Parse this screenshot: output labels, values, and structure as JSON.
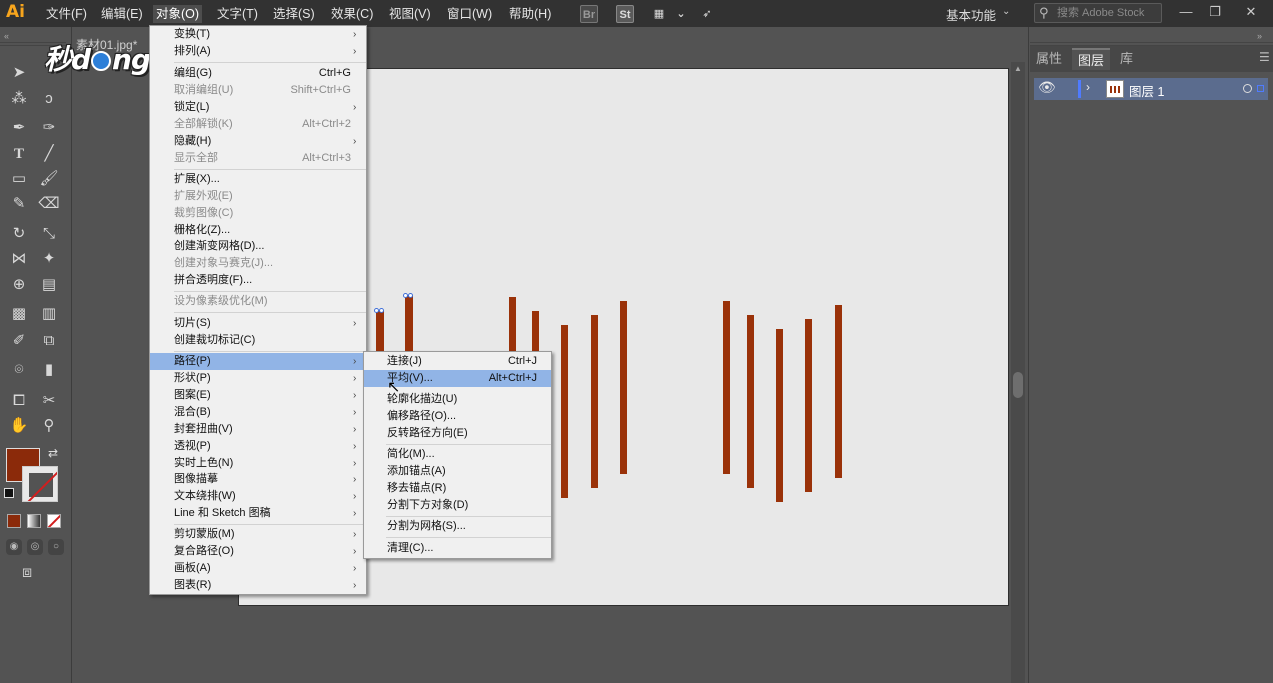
{
  "app": {
    "logo": "Ai",
    "menus": [
      "文件(F)",
      "编辑(E)",
      "对象(O)",
      "文字(T)",
      "选择(S)",
      "效果(C)",
      "视图(V)",
      "窗口(W)",
      "帮助(H)"
    ],
    "bridge_label": "Br",
    "stock_label": "St",
    "workspace": "基本功能",
    "stock_search_placeholder": "搜索 Adobe Stock"
  },
  "document": {
    "tab_title": "素材01.jpg*",
    "watermark": {
      "part1": "秒d",
      "part2": "ng视频"
    }
  },
  "colors": {
    "fill": "#8b2a0a",
    "bars": "#9a3209",
    "layer_color": "#4f7bff",
    "menu_highlight": "#91b4e6"
  },
  "object_menu": {
    "items": [
      {
        "label": "变换(T)",
        "shortcut": "",
        "submenu": true,
        "disabled": false
      },
      {
        "label": "排列(A)",
        "shortcut": "",
        "submenu": true,
        "disabled": false
      },
      {
        "label": "编组(G)",
        "shortcut": "Ctrl+G",
        "submenu": false,
        "disabled": false
      },
      {
        "label": "取消编组(U)",
        "shortcut": "Shift+Ctrl+G",
        "submenu": false,
        "disabled": true
      },
      {
        "label": "锁定(L)",
        "shortcut": "",
        "submenu": true,
        "disabled": false
      },
      {
        "label": "全部解锁(K)",
        "shortcut": "Alt+Ctrl+2",
        "submenu": false,
        "disabled": true
      },
      {
        "label": "隐藏(H)",
        "shortcut": "",
        "submenu": true,
        "disabled": false
      },
      {
        "label": "显示全部",
        "shortcut": "Alt+Ctrl+3",
        "submenu": false,
        "disabled": true
      },
      {
        "label": "扩展(X)...",
        "shortcut": "",
        "submenu": false,
        "disabled": false
      },
      {
        "label": "扩展外观(E)",
        "shortcut": "",
        "submenu": false,
        "disabled": true
      },
      {
        "label": "裁剪图像(C)",
        "shortcut": "",
        "submenu": false,
        "disabled": true
      },
      {
        "label": "栅格化(Z)...",
        "shortcut": "",
        "submenu": false,
        "disabled": false
      },
      {
        "label": "创建渐变网格(D)...",
        "shortcut": "",
        "submenu": false,
        "disabled": false
      },
      {
        "label": "创建对象马赛克(J)...",
        "shortcut": "",
        "submenu": false,
        "disabled": true
      },
      {
        "label": "拼合透明度(F)...",
        "shortcut": "",
        "submenu": false,
        "disabled": false
      },
      {
        "label": "设为像素级优化(M)",
        "shortcut": "",
        "submenu": false,
        "disabled": true
      },
      {
        "label": "切片(S)",
        "shortcut": "",
        "submenu": true,
        "disabled": false
      },
      {
        "label": "创建裁切标记(C)",
        "shortcut": "",
        "submenu": false,
        "disabled": false
      },
      {
        "label": "路径(P)",
        "shortcut": "",
        "submenu": true,
        "disabled": false,
        "highlight": true
      },
      {
        "label": "形状(P)",
        "shortcut": "",
        "submenu": true,
        "disabled": false
      },
      {
        "label": "图案(E)",
        "shortcut": "",
        "submenu": true,
        "disabled": false
      },
      {
        "label": "混合(B)",
        "shortcut": "",
        "submenu": true,
        "disabled": false
      },
      {
        "label": "封套扭曲(V)",
        "shortcut": "",
        "submenu": true,
        "disabled": false
      },
      {
        "label": "透视(P)",
        "shortcut": "",
        "submenu": true,
        "disabled": false
      },
      {
        "label": "实时上色(N)",
        "shortcut": "",
        "submenu": true,
        "disabled": false
      },
      {
        "label": "图像描摹",
        "shortcut": "",
        "submenu": true,
        "disabled": false
      },
      {
        "label": "文本绕排(W)",
        "shortcut": "",
        "submenu": true,
        "disabled": false
      },
      {
        "label": "Line 和 Sketch 图稿",
        "shortcut": "",
        "submenu": true,
        "disabled": false
      },
      {
        "label": "剪切蒙版(M)",
        "shortcut": "",
        "submenu": true,
        "disabled": false
      },
      {
        "label": "复合路径(O)",
        "shortcut": "",
        "submenu": true,
        "disabled": false
      },
      {
        "label": "画板(A)",
        "shortcut": "",
        "submenu": true,
        "disabled": false
      },
      {
        "label": "图表(R)",
        "shortcut": "",
        "submenu": true,
        "disabled": false
      }
    ]
  },
  "path_menu": {
    "items": [
      {
        "label": "连接(J)",
        "shortcut": "Ctrl+J"
      },
      {
        "label": "平均(V)...",
        "shortcut": "Alt+Ctrl+J",
        "highlight": true
      },
      {
        "label": "轮廓化描边(U)",
        "shortcut": ""
      },
      {
        "label": "偏移路径(O)...",
        "shortcut": ""
      },
      {
        "label": "反转路径方向(E)",
        "shortcut": ""
      },
      {
        "label": "简化(M)...",
        "shortcut": ""
      },
      {
        "label": "添加锚点(A)",
        "shortcut": ""
      },
      {
        "label": "移去锚点(R)",
        "shortcut": ""
      },
      {
        "label": "分割下方对象(D)",
        "shortcut": ""
      },
      {
        "label": "分割为网格(S)...",
        "shortcut": ""
      },
      {
        "label": "清理(C)...",
        "shortcut": ""
      }
    ]
  },
  "panel": {
    "tabs": [
      "属性",
      "图层",
      "库"
    ],
    "active_tab": "图层",
    "layers": [
      {
        "name": "图层 1"
      }
    ]
  }
}
